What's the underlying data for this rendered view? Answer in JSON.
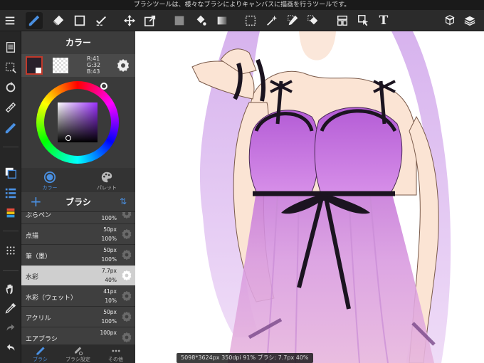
{
  "status_bar": {
    "message": "ブラシツールは、様々なブラシによりキャンバスに描画を行うツールです。"
  },
  "toolbar": {
    "items": [
      "menu-icon",
      "brush-icon",
      "eraser-icon",
      "rectangle-icon",
      "magic-select-icon",
      "move-icon",
      "transform-icon",
      "fill-color-icon",
      "bucket-icon",
      "gradient-icon",
      "select-rect-icon",
      "magic-wand-icon",
      "select-pen-icon",
      "select-eraser-icon",
      "layout-icon",
      "select-arrow-icon",
      "text-icon",
      "materials-icon",
      "layers-icon"
    ],
    "text_tool_label": "T"
  },
  "color_panel": {
    "title": "カラー",
    "foreground_color": "#29202b",
    "rgb": {
      "r": "R:41",
      "g": "G:32",
      "b": "B:43"
    },
    "tabs": [
      {
        "label": "カラー",
        "active": true
      },
      {
        "label": "パレット",
        "active": false
      }
    ]
  },
  "brush_panel": {
    "title": "ブラシ",
    "brushes": [
      {
        "name": "ぶらペン",
        "size": "",
        "opacity": "100%",
        "selected": false
      },
      {
        "name": "点描",
        "size": "50px",
        "opacity": "100%",
        "selected": false
      },
      {
        "name": "筆（墨）",
        "size": "50px",
        "opacity": "100%",
        "selected": false
      },
      {
        "name": "水彩",
        "size": "7.7px",
        "opacity": "40%",
        "selected": true
      },
      {
        "name": "水彩（ウェット）",
        "size": "41px",
        "opacity": "10%",
        "selected": false
      },
      {
        "name": "アクリル",
        "size": "50px",
        "opacity": "100%",
        "selected": false
      },
      {
        "name": "エアブラシ",
        "size": "100px",
        "opacity": "",
        "selected": false
      }
    ]
  },
  "bottom_tabs": [
    {
      "label": "ブラシ",
      "active": true
    },
    {
      "label": "ブラシ設定",
      "active": false
    },
    {
      "label": "その他",
      "active": false
    }
  ],
  "canvas": {
    "info": "5098*3624px 350dpi 91% ブラシ: 7.7px 40%"
  },
  "colors": {
    "accent": "#4a90e2",
    "selected_outline": "#c0392b"
  }
}
